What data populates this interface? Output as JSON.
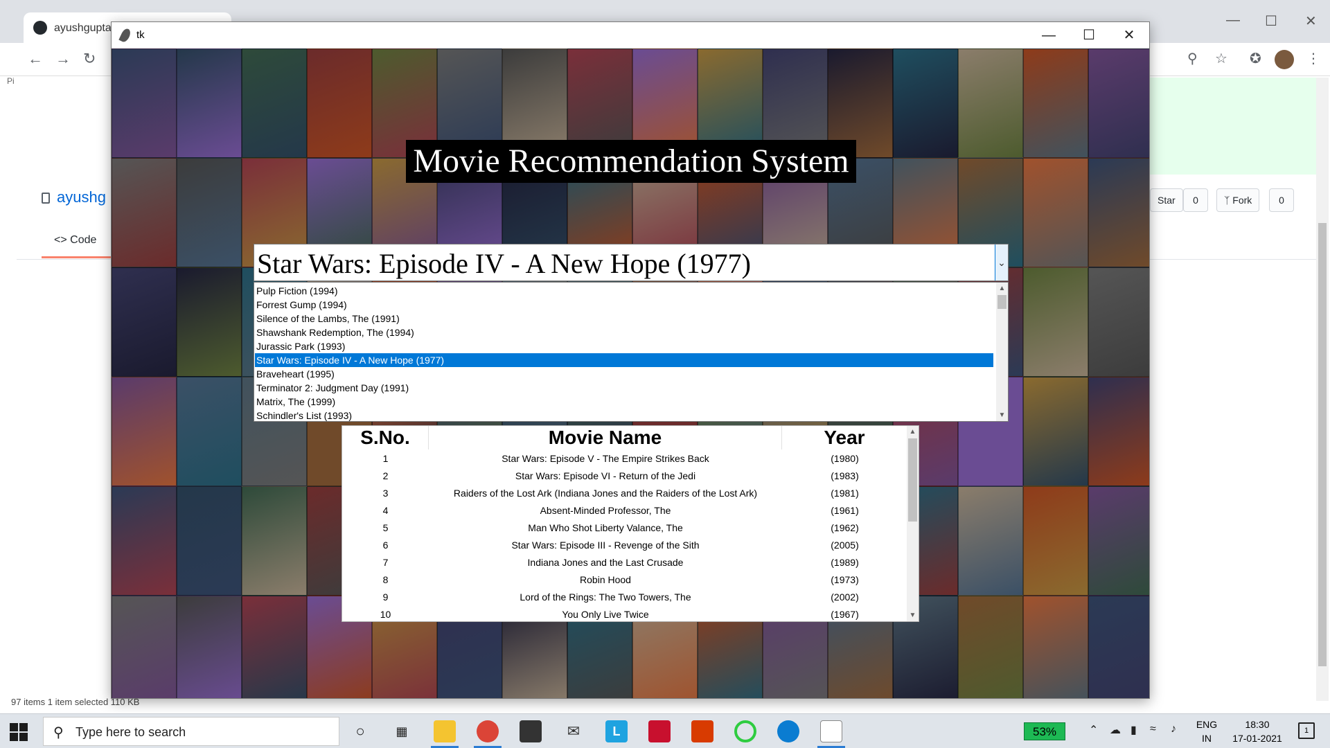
{
  "browser": {
    "tab_title": "ayushgupta7",
    "repo_name": "ayushg",
    "pin_label": "Pi",
    "code_tab": "Code",
    "star_label": "Star",
    "star_count": "0",
    "fork_label": "Fork",
    "fork_count": "0",
    "status_bar": "97 items    1 item selected  110 KB"
  },
  "tk_window": {
    "title": "tk",
    "app_title": "Movie Recommendation System",
    "selected_movie": "Star Wars: Episode IV - A New Hope (1977)",
    "list_items": [
      "Pulp Fiction (1994)",
      "Forrest Gump (1994)",
      "Silence of the Lambs, The (1991)",
      "Shawshank Redemption, The (1994)",
      "Jurassic Park (1993)",
      "Star Wars: Episode IV - A New Hope (1977)",
      "Braveheart (1995)",
      "Terminator 2: Judgment Day (1991)",
      "Matrix, The (1999)",
      "Schindler's List (1993)"
    ],
    "selected_index": 5,
    "table": {
      "headers": [
        "S.No.",
        "Movie Name",
        "Year"
      ],
      "rows": [
        [
          "1",
          "Star Wars: Episode V - The Empire Strikes Back",
          "(1980)"
        ],
        [
          "2",
          "Star Wars: Episode VI - Return of the Jedi",
          "(1983)"
        ],
        [
          "3",
          "Raiders of the Lost Ark (Indiana Jones and the Raiders of the Lost Ark)",
          "(1981)"
        ],
        [
          "4",
          "Absent-Minded Professor, The",
          "(1961)"
        ],
        [
          "5",
          "Man Who Shot Liberty Valance, The",
          "(1962)"
        ],
        [
          "6",
          "Star Wars: Episode III - Revenge of the Sith",
          "(2005)"
        ],
        [
          "7",
          "Indiana Jones and the Last Crusade",
          "(1989)"
        ],
        [
          "8",
          "Robin Hood",
          "(1973)"
        ],
        [
          "9",
          "Lord of the Rings: The Two Towers, The",
          "(2002)"
        ],
        [
          "10",
          "You Only Live Twice",
          "(1967)"
        ]
      ]
    }
  },
  "taskbar": {
    "search_placeholder": "Type here to search",
    "battery": "53%",
    "lang_line1": "ENG",
    "lang_line2": "IN",
    "time": "18:30",
    "date": "17-01-2021",
    "notifications": "1"
  },
  "colors": {
    "selection": "#0078d7",
    "title_bg": "#000000",
    "battery": "#1db954"
  },
  "icons": [
    "github-icon",
    "back-icon",
    "forward-icon",
    "reload-icon",
    "zoom-icon",
    "bookmark-star-icon",
    "extensions-icon",
    "menu-icon",
    "feather-icon",
    "minimize-icon",
    "maximize-icon",
    "close-icon",
    "dropdown-arrow-icon",
    "windows-start-icon",
    "search-icon",
    "task-view-icon"
  ]
}
